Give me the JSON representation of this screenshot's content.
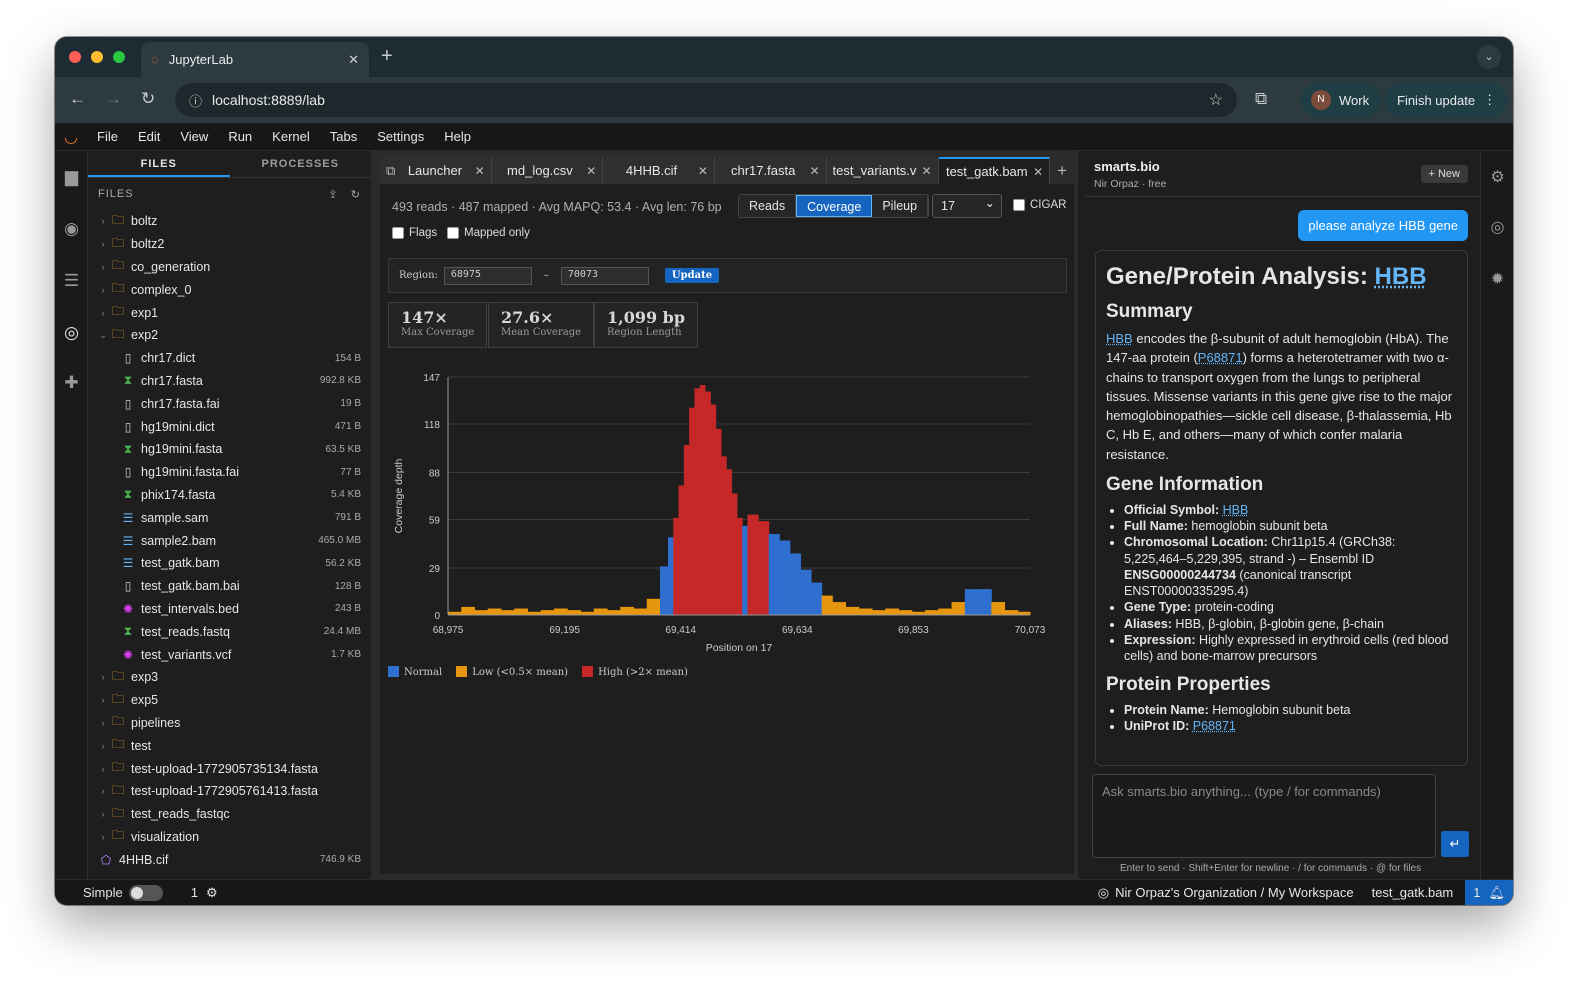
{
  "browser": {
    "tab_title": "JupyterLab",
    "url": "localhost:8889/lab",
    "profile_initial": "N",
    "profile": "Work",
    "update": "Finish update"
  },
  "menu": [
    "File",
    "Edit",
    "View",
    "Run",
    "Kernel",
    "Tabs",
    "Settings",
    "Help"
  ],
  "panel": {
    "tabs": [
      "FILES",
      "PROCESSES"
    ],
    "header": "FILES"
  },
  "files": [
    {
      "name": "boltz",
      "type": "folder",
      "indent": 0,
      "open": false
    },
    {
      "name": "boltz2",
      "type": "folder",
      "indent": 0,
      "open": false
    },
    {
      "name": "co_generation",
      "type": "folder",
      "indent": 0,
      "open": false
    },
    {
      "name": "complex_0",
      "type": "folder",
      "indent": 0,
      "open": false
    },
    {
      "name": "exp1",
      "type": "folder",
      "indent": 0,
      "open": false
    },
    {
      "name": "exp2",
      "type": "folder",
      "indent": 0,
      "open": true
    },
    {
      "name": "chr17.dict",
      "type": "file",
      "indent": 1,
      "size": "154 B"
    },
    {
      "name": "chr17.fasta",
      "type": "fasta",
      "indent": 1,
      "size": "992.8 KB"
    },
    {
      "name": "chr17.fasta.fai",
      "type": "file",
      "indent": 1,
      "size": "19 B"
    },
    {
      "name": "hg19mini.dict",
      "type": "file",
      "indent": 1,
      "size": "471 B"
    },
    {
      "name": "hg19mini.fasta",
      "type": "fasta",
      "indent": 1,
      "size": "63.5 KB"
    },
    {
      "name": "hg19mini.fasta.fai",
      "type": "file",
      "indent": 1,
      "size": "77 B"
    },
    {
      "name": "phix174.fasta",
      "type": "fasta",
      "indent": 1,
      "size": "5.4 KB"
    },
    {
      "name": "sample.sam",
      "type": "align",
      "indent": 1,
      "size": "791 B"
    },
    {
      "name": "sample2.bam",
      "type": "align",
      "indent": 1,
      "size": "465.0 MB"
    },
    {
      "name": "test_gatk.bam",
      "type": "align",
      "indent": 1,
      "size": "56.2 KB"
    },
    {
      "name": "test_gatk.bam.bai",
      "type": "file",
      "indent": 1,
      "size": "128 B"
    },
    {
      "name": "test_intervals.bed",
      "type": "bed",
      "indent": 1,
      "size": "243 B"
    },
    {
      "name": "test_reads.fastq",
      "type": "fasta",
      "indent": 1,
      "size": "24.4 MB"
    },
    {
      "name": "test_variants.vcf",
      "type": "bed",
      "indent": 1,
      "size": "1.7 KB"
    },
    {
      "name": "exp3",
      "type": "folder",
      "indent": 0,
      "open": false
    },
    {
      "name": "exp5",
      "type": "folder",
      "indent": 0,
      "open": false
    },
    {
      "name": "pipelines",
      "type": "folder",
      "indent": 0,
      "open": false
    },
    {
      "name": "test",
      "type": "folder",
      "indent": 0,
      "open": false
    },
    {
      "name": "test-upload-1772905735134.fasta",
      "type": "folder",
      "indent": 0,
      "open": false
    },
    {
      "name": "test-upload-1772905761413.fasta",
      "type": "folder",
      "indent": 0,
      "open": false
    },
    {
      "name": "test_reads_fastqc",
      "type": "folder",
      "indent": 0,
      "open": false
    },
    {
      "name": "visualization",
      "type": "folder",
      "indent": 0,
      "open": false
    },
    {
      "name": "4HHB.cif",
      "type": "mol",
      "indent": -1,
      "size": "746.9 KB"
    }
  ],
  "doc_tabs": [
    {
      "label": "Launcher",
      "active": false
    },
    {
      "label": "md_log.csv",
      "active": false
    },
    {
      "label": "4HHB.cif",
      "active": false
    },
    {
      "label": "chr17.fasta",
      "active": false
    },
    {
      "label": "test_variants.vcf",
      "active": false
    },
    {
      "label": "test_gatk.bam",
      "active": true
    }
  ],
  "viewer": {
    "stats": "493 reads · 487 mapped · Avg MAPQ: 53.4 · Avg len: 76 bp",
    "modes": [
      {
        "label": "Reads",
        "active": false
      },
      {
        "label": "Coverage",
        "active": true
      },
      {
        "label": "Pileup",
        "active": false
      }
    ],
    "chrom": "17",
    "cigar": "CIGAR",
    "flags": "Flags",
    "mapped_only": "Mapped only",
    "region_label": "Region:",
    "region_start": "68975",
    "region_sep": "–",
    "region_end": "70073",
    "update": "Update",
    "cards": [
      {
        "value": "147×",
        "label": "Max Coverage"
      },
      {
        "value": "27.6×",
        "label": "Mean Coverage"
      },
      {
        "value": "1,099 bp",
        "label": "Region Length"
      }
    ],
    "legend": [
      {
        "label": "Normal",
        "color": "#2f6fd0"
      },
      {
        "label": "Low (<0.5× mean)",
        "color": "#e6960f"
      },
      {
        "label": "High (>2× mean)",
        "color": "#c62828"
      }
    ]
  },
  "chart_data": {
    "type": "area",
    "title": "",
    "xlabel": "Position on 17",
    "ylabel": "Coverage depth",
    "xlim": [
      68975,
      70073
    ],
    "ylim": [
      0,
      147
    ],
    "xticks": [
      "68,975",
      "69,195",
      "69,414",
      "69,634",
      "69,853",
      "70,073"
    ],
    "yticks": [
      "0",
      "29",
      "59",
      "88",
      "118",
      "147"
    ],
    "x": [
      68975,
      69000,
      69025,
      69050,
      69075,
      69100,
      69125,
      69150,
      69175,
      69200,
      69225,
      69250,
      69275,
      69300,
      69325,
      69350,
      69375,
      69390,
      69400,
      69410,
      69420,
      69430,
      69440,
      69450,
      69460,
      69470,
      69480,
      69490,
      69500,
      69510,
      69520,
      69530,
      69540,
      69560,
      69580,
      69600,
      69620,
      69640,
      69660,
      69680,
      69700,
      69725,
      69750,
      69775,
      69800,
      69825,
      69850,
      69875,
      69900,
      69925,
      69950,
      69975,
      70000,
      70025,
      70050,
      70073
    ],
    "y": [
      2,
      5,
      3,
      4,
      3,
      4,
      2,
      3,
      4,
      3,
      2,
      4,
      3,
      5,
      4,
      10,
      30,
      48,
      60,
      80,
      105,
      128,
      140,
      142,
      138,
      130,
      115,
      98,
      90,
      75,
      60,
      55,
      62,
      58,
      50,
      46,
      38,
      28,
      20,
      12,
      8,
      5,
      4,
      3,
      4,
      3,
      2,
      3,
      4,
      8,
      16,
      16,
      8,
      3,
      2,
      1
    ],
    "series": [
      {
        "name": "Normal",
        "color": "#2f6fd0"
      },
      {
        "name": "Low (<0.5× mean)",
        "color": "#e6960f"
      },
      {
        "name": "High (>2× mean)",
        "color": "#c62828"
      }
    ],
    "thresholds": {
      "low": 13.8,
      "high": 55.2
    },
    "grid": true,
    "legend": "bottom-left"
  },
  "assistant": {
    "title": "smarts.bio",
    "subtitle": "Nir Orpaz · free",
    "new": "+ New",
    "user_msg": "please analyze HBB gene",
    "h1": "Gene/Protein Analysis: ",
    "h1_link": "HBB",
    "summary_h": "Summary",
    "summary_p1_link": "HBB",
    "summary_p1": " encodes the β-subunit of adult hemoglobin (HbA). The 147-aa protein (",
    "summary_p2_link": "P68871",
    "summary_p2": ") forms a heterotetramer with two α-chains to transport oxygen from the lungs to peripheral tissues. Missense variants in this gene give rise to the major hemoglobinopathies—sickle cell disease, β-thalassemia, Hb C, Hb E, and others—many of which confer malaria resistance.",
    "gene_h": "Gene Information",
    "gene_items": [
      {
        "k": "Official Symbol:",
        "v": "",
        "link": "HBB"
      },
      {
        "k": "Full Name:",
        "v": " hemoglobin subunit beta"
      },
      {
        "k": "Chromosomal Location:",
        "v": " Chr11p15.4 (GRCh38: 5,225,464–5,229,395, strand -) – Ensembl ID ",
        "b": "ENSG00000244734",
        "v2": " (canonical transcript ENST00000335295.4)"
      },
      {
        "k": "Gene Type:",
        "v": " protein-coding"
      },
      {
        "k": "Aliases:",
        "v": " HBB, β-globin, β-globin gene, β-chain"
      },
      {
        "k": "Expression:",
        "v": " Highly expressed in erythroid cells (red blood cells) and bone-marrow precursors"
      }
    ],
    "protein_h": "Protein Properties",
    "protein_items": [
      {
        "k": "Protein Name:",
        "v": " Hemoglobin subunit beta"
      },
      {
        "k": "UniProt ID:",
        "v": " ",
        "link": "P68871"
      }
    ],
    "placeholder": "Ask smarts.bio anything... (type / for commands)",
    "hint": "Enter to send · Shift+Enter for newline · / for commands · @ for files"
  },
  "status": {
    "mode": "Simple",
    "count": "1",
    "org": "Nir Orpaz's Organization / My Workspace",
    "file": "test_gatk.bam",
    "notif": "1"
  }
}
